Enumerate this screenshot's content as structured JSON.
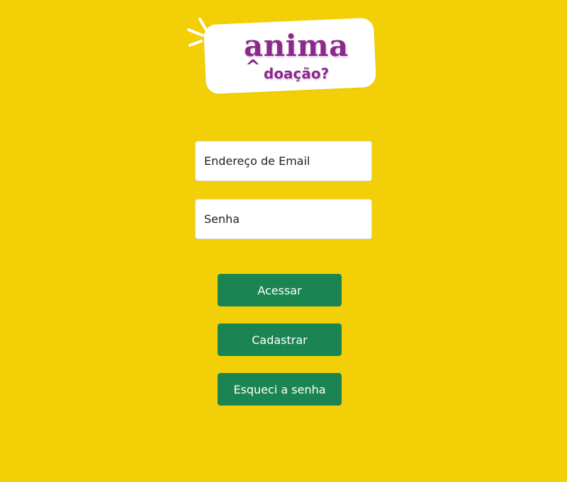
{
  "logo": {
    "word": "anima",
    "accent": "^",
    "subtitle": "doação?",
    "color": "#8a2a8a"
  },
  "form": {
    "email_placeholder": "Endereço de Email",
    "password_placeholder": "Senha"
  },
  "actions": {
    "login_label": "Acessar",
    "register_label": "Cadastrar",
    "forgot_label": "Esqueci a senha"
  },
  "colors": {
    "background": "#f2cf07",
    "button": "#1b8552",
    "button_text": "#ffffff"
  }
}
